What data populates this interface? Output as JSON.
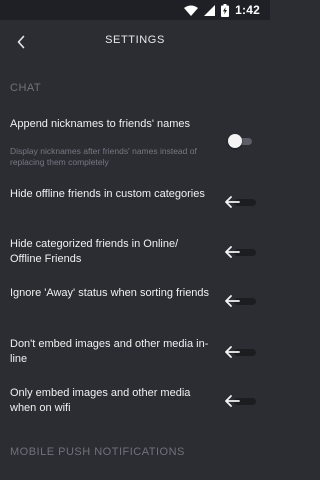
{
  "status": {
    "time": "1:42",
    "battery_icon": "battery-charging-icon",
    "wifi_icon": "wifi-icon",
    "signal_icon": "signal-icon"
  },
  "appbar": {
    "title": "SETTINGS",
    "back_icon": "chevron-left-icon"
  },
  "sections": {
    "chat": "CHAT",
    "mobile_push": "MOBILE PUSH NOTIFICATIONS"
  },
  "settings": [
    {
      "title": "Append nicknames to friends' names",
      "description": "Display nicknames after friends' names instead of replacing them completely",
      "enabled": false
    },
    {
      "title": "Hide offline friends in custom categories",
      "enabled": false
    },
    {
      "title": "Hide categorized friends in Online/ Offline Friends",
      "enabled": false
    },
    {
      "title": "Ignore 'Away' status when sorting friends",
      "enabled": false
    },
    {
      "title": "Don't embed images and other media in-line",
      "enabled": false
    },
    {
      "title": "Only embed images and other media when on wifi",
      "enabled": false
    }
  ],
  "colors": {
    "background": "#2b2d33",
    "statusbar": "#1f2025",
    "section_header": "#6f727a",
    "description": "#767982"
  }
}
